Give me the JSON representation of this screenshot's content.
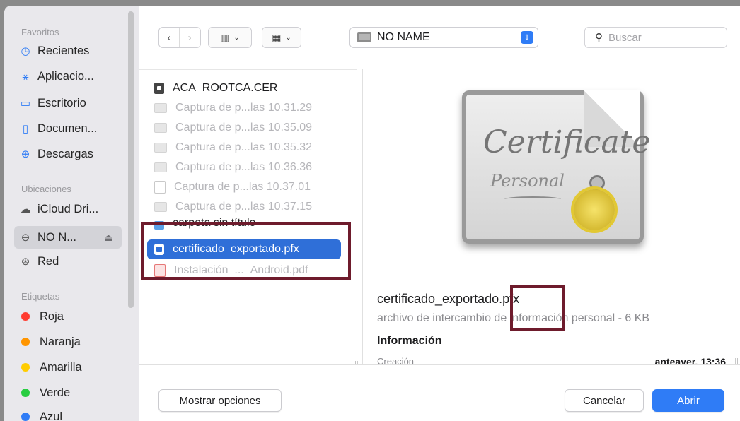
{
  "sidebar": {
    "favorites_label": "Favoritos",
    "favorites": [
      {
        "label": "Recientes",
        "icon": "clock-icon"
      },
      {
        "label": "Aplicacio...",
        "icon": "apps-icon"
      },
      {
        "label": "Escritorio",
        "icon": "desktop-icon"
      },
      {
        "label": "Documen...",
        "icon": "document-icon"
      },
      {
        "label": "Descargas",
        "icon": "download-icon"
      }
    ],
    "locations_label": "Ubicaciones",
    "locations": [
      {
        "label": "iCloud Dri...",
        "icon": "cloud-icon"
      },
      {
        "label": "NO N...",
        "icon": "drive-icon",
        "selected": true
      },
      {
        "label": "Red",
        "icon": "network-icon"
      }
    ],
    "tags_label": "Etiquetas",
    "tags": [
      {
        "label": "Roja",
        "color": "#ff3b30"
      },
      {
        "label": "Naranja",
        "color": "#ff9500"
      },
      {
        "label": "Amarilla",
        "color": "#ffcc00"
      },
      {
        "label": "Verde",
        "color": "#28cd41"
      },
      {
        "label": "Azul",
        "color": "#2f7cf6"
      }
    ]
  },
  "toolbar": {
    "location": "NO NAME",
    "search_placeholder": "Buscar"
  },
  "files": [
    {
      "name": "ACA_ROOTCA.CER",
      "type": "cer",
      "dim": false
    },
    {
      "name": "Captura de p...las 10.31.29",
      "type": "img",
      "dim": true
    },
    {
      "name": "Captura de p...las 10.35.09",
      "type": "img",
      "dim": true
    },
    {
      "name": "Captura de p...las 10.35.32",
      "type": "img",
      "dim": true
    },
    {
      "name": "Captura de p...las 10.36.36",
      "type": "img",
      "dim": true
    },
    {
      "name": "Captura de p...las 10.37.01",
      "type": "blank",
      "dim": true
    },
    {
      "name": "Captura de p...las 10.37.15",
      "type": "img",
      "dim": true
    },
    {
      "name": "carpeta sin título",
      "type": "folder",
      "dim": false
    },
    {
      "name": "certificado_exportado.pfx",
      "type": "pfx",
      "dim": false,
      "selected": true
    },
    {
      "name": "Instalación_..._Android.pdf",
      "type": "pdf",
      "dim": true
    }
  ],
  "preview": {
    "icon_text_1": "Certificate",
    "icon_text_2": "Personal",
    "title": "certificado_exportado.pfx",
    "subtitle": "archivo de intercambio de información personal - 6 KB",
    "info_heading": "Información",
    "creation_label": "Creación",
    "creation_value": "anteayer, 13:36"
  },
  "buttons": {
    "options": "Mostrar opciones",
    "cancel": "Cancelar",
    "open": "Abrir"
  }
}
